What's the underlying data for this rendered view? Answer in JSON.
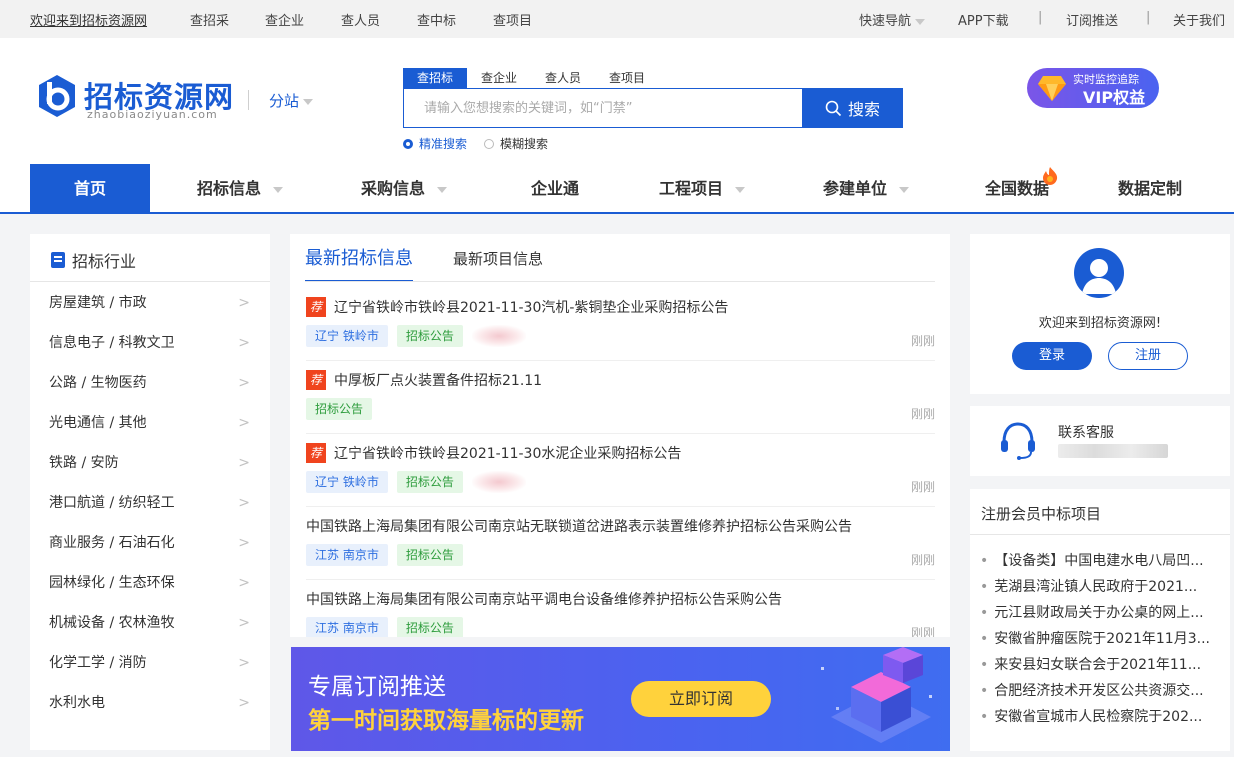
{
  "topbar": {
    "welcome": "欢迎来到招标资源网",
    "links": [
      "查招采",
      "查企业",
      "查人员",
      "查中标",
      "查项目"
    ],
    "quick_nav": "快速导航",
    "app_download": "APP下载",
    "subscribe": "订阅推送",
    "about": "关于我们",
    "divider": "|"
  },
  "header": {
    "logo_text": "招标资源网",
    "logo_sub": "zhaobiaoziyuan.com",
    "branch": "分站",
    "search_tabs": [
      "查招标",
      "查企业",
      "查人员",
      "查项目"
    ],
    "search_placeholder": "请输入您想搜索的关键词，如“门禁”",
    "search_button": "搜索",
    "mode_exact": "精准搜索",
    "mode_fuzzy": "模糊搜索",
    "vip_line1": "实时监控追踪",
    "vip_line2": "VIP权益"
  },
  "nav": {
    "items": [
      "首页",
      "招标信息",
      "采购信息",
      "企业通",
      "工程项目",
      "参建单位",
      "全国数据",
      "数据定制"
    ]
  },
  "sidebar": {
    "title": "招标行业",
    "categories": [
      "房屋建筑 / 市政",
      "信息电子 / 科教文卫",
      "公路 / 生物医药",
      "光电通信 / 其他",
      "铁路 / 安防",
      "港口航道 / 纺织轻工",
      "商业服务 / 石油石化",
      "园林绿化 / 生态环保",
      "机械设备 / 农林渔牧",
      "化学工学 / 消防",
      "水利水电"
    ]
  },
  "center": {
    "tab_active": "最新招标信息",
    "tab_other": "最新项目信息",
    "rec_badge": "荐",
    "items": [
      {
        "title": "辽宁省铁岭市铁岭县2021-11-30汽机-紫铜垫企业采购招标公告",
        "region": "辽宁 铁岭市",
        "type": "招标公告",
        "time": "刚刚",
        "rec": true,
        "blur": true
      },
      {
        "title": "中厚板厂点火装置备件招标21.11",
        "region": "",
        "type": "招标公告",
        "time": "刚刚",
        "rec": true,
        "blur": false
      },
      {
        "title": "辽宁省铁岭市铁岭县2021-11-30水泥企业采购招标公告",
        "region": "辽宁 铁岭市",
        "type": "招标公告",
        "time": "刚刚",
        "rec": true,
        "blur": true
      },
      {
        "title": "中国铁路上海局集团有限公司南京站无联锁道岔进路表示装置维修养护招标公告采购公告",
        "region": "江苏 南京市",
        "type": "招标公告",
        "time": "刚刚",
        "rec": false,
        "blur": false
      },
      {
        "title": "中国铁路上海局集团有限公司南京站平调电台设备维修养护招标公告采购公告",
        "region": "江苏 南京市",
        "type": "招标公告",
        "time": "刚刚",
        "rec": false,
        "blur": false
      }
    ]
  },
  "banner": {
    "line1": "专属订阅推送",
    "line2": "第一时间获取海量标的更新",
    "button": "立即订阅"
  },
  "user": {
    "welcome": "欢迎来到招标资源网!",
    "login": "登录",
    "register": "注册"
  },
  "service": {
    "label": "联系客服"
  },
  "won": {
    "title": "注册会员中标项目",
    "items": [
      "【设备类】中国电建水电八局凹...",
      "芜湖县湾沚镇人民政府于2021...",
      "元江县财政局关于办公桌的网上...",
      "安徽省肿瘤医院于2021年11月3...",
      "来安县妇女联合会于2021年11...",
      "合肥经济技术开发区公共资源交...",
      "安徽省宣城市人民检察院于202..."
    ]
  },
  "colors": {
    "brand": "#1a5cd3",
    "rec": "#f0441e",
    "highlight": "#ffd23c"
  }
}
